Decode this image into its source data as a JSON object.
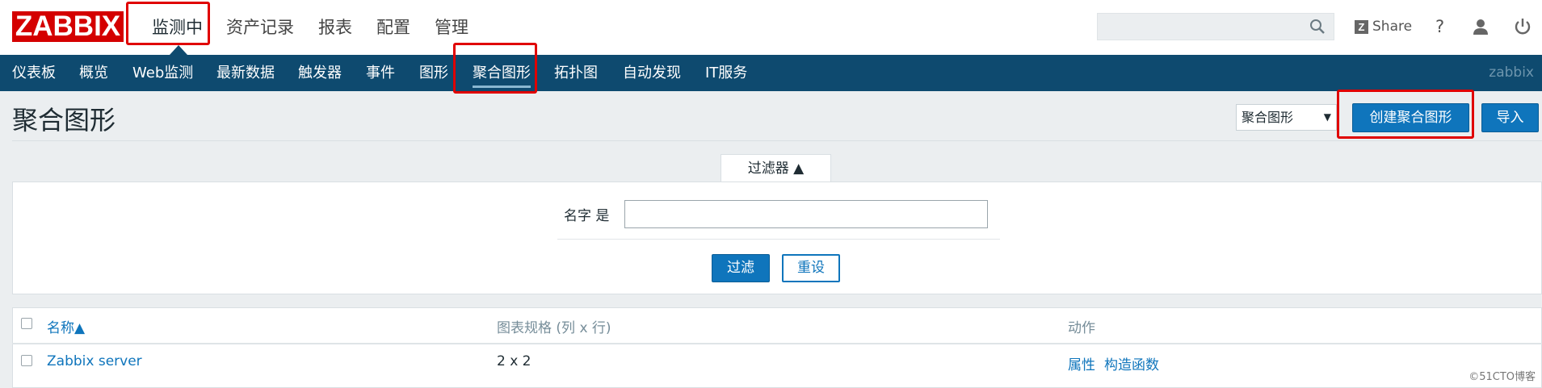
{
  "logo": "ZABBIX",
  "top_menu": [
    {
      "label": "监测中",
      "active": true
    },
    {
      "label": "资产记录"
    },
    {
      "label": "报表"
    },
    {
      "label": "配置"
    },
    {
      "label": "管理"
    }
  ],
  "header": {
    "search": {
      "value": "",
      "placeholder": "",
      "icon": "search-icon"
    },
    "share_label": "Share",
    "help_label": "?",
    "icons": [
      "share-icon",
      "help-icon",
      "user-icon",
      "power-icon"
    ]
  },
  "nav": {
    "items": [
      {
        "label": "仪表板"
      },
      {
        "label": "概览"
      },
      {
        "label": "Web监测"
      },
      {
        "label": "最新数据"
      },
      {
        "label": "触发器"
      },
      {
        "label": "事件"
      },
      {
        "label": "图形"
      },
      {
        "label": "聚合图形",
        "active": true
      },
      {
        "label": "拓扑图"
      },
      {
        "label": "自动发现"
      },
      {
        "label": "IT服务"
      }
    ],
    "right_label": "zabbix"
  },
  "page": {
    "title": "聚合图形",
    "select_value": "聚合图形",
    "create_button": "创建聚合图形",
    "import_button": "导入"
  },
  "filter": {
    "tab_label": "过滤器 ▲",
    "name_label": "名字 是",
    "name_value": "",
    "apply_button": "过滤",
    "reset_button": "重设"
  },
  "table": {
    "columns": [
      "名称▲",
      "图表规格 (列 x 行)",
      "动作"
    ],
    "rows": [
      {
        "name": "Zabbix server",
        "dimensions": "2 x 2",
        "action_properties": "属性",
        "action_constructor": "构造函数"
      }
    ]
  },
  "watermark": "©51CTO博客",
  "colors": {
    "brand": "#d40000",
    "nav_bg": "#0e4a6f",
    "accent": "#0f75bc",
    "highlight": "#e00000"
  }
}
